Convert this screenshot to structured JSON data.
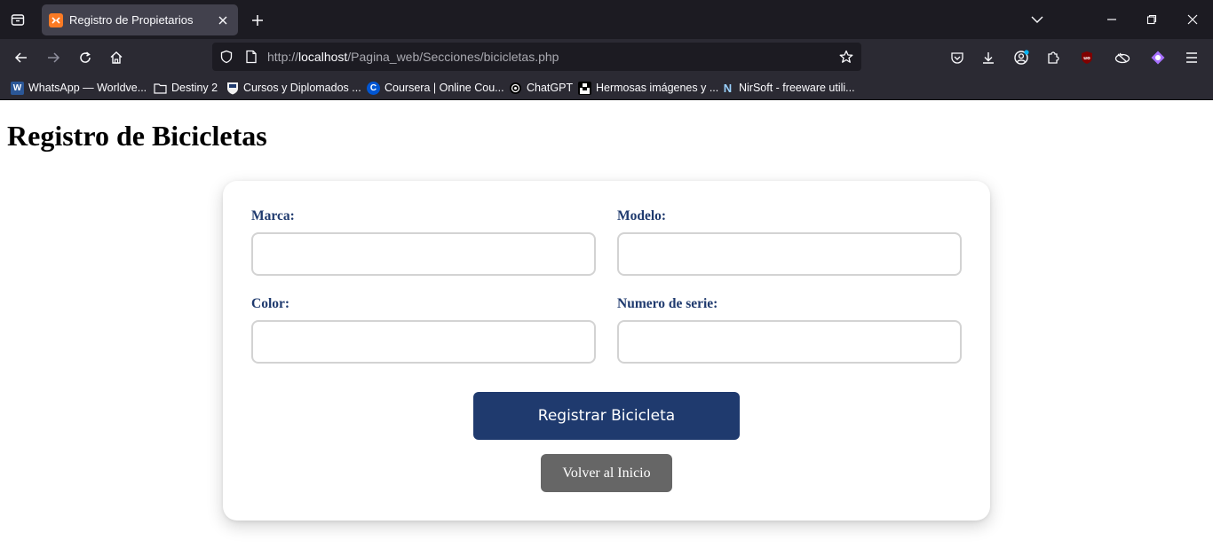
{
  "browser": {
    "tab": {
      "title": "Registro de Propietarios",
      "favicon": "xampp-icon"
    },
    "address": {
      "scheme": "http://",
      "host": "localhost",
      "path": "/Pagina_web/Secciones/bicicletas.php"
    },
    "bookmarks": [
      {
        "label": "WhatsApp — Worldve...",
        "icon": "W"
      },
      {
        "label": "Destiny 2",
        "icon": "folder"
      },
      {
        "label": "Cursos y Diplomados ...",
        "icon": "shield"
      },
      {
        "label": "Coursera | Online Cou...",
        "icon": "C"
      },
      {
        "label": "ChatGPT",
        "icon": "openai"
      },
      {
        "label": "Hermosas imágenes y ...",
        "icon": "unsplash"
      },
      {
        "label": "NirSoft - freeware utili...",
        "icon": "N"
      }
    ]
  },
  "page": {
    "heading": "Registro de Bicicletas",
    "form": {
      "fields": [
        {
          "label": "Marca:",
          "value": ""
        },
        {
          "label": "Modelo:",
          "value": ""
        },
        {
          "label": "Color:",
          "value": ""
        },
        {
          "label": "Numero de serie:",
          "value": ""
        }
      ],
      "submit_label": "Registrar Bicicleta",
      "back_label": "Volver al Inicio"
    }
  },
  "colors": {
    "primary": "#1f3a6e",
    "secondary": "#666666",
    "label": "#1f3a6e",
    "chrome_dark": "#1c1b22",
    "chrome": "#2b2a33"
  }
}
